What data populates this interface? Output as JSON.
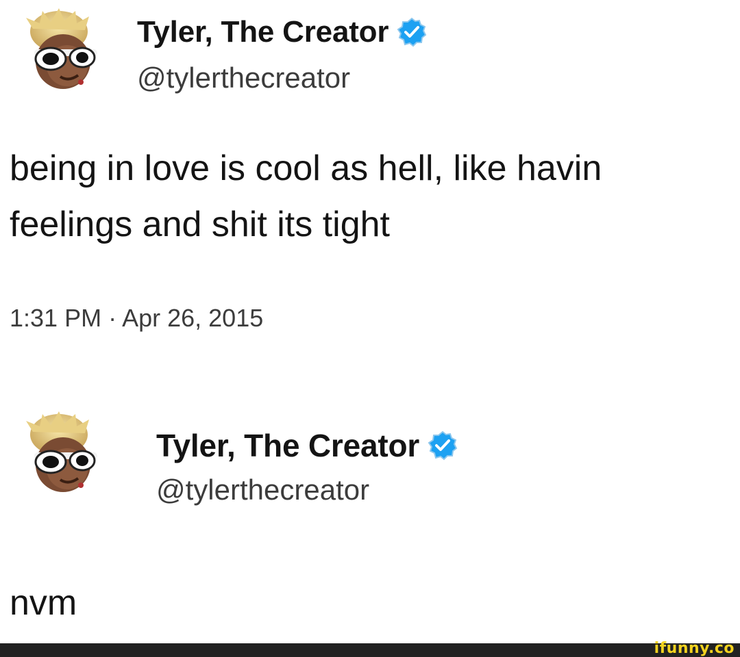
{
  "tweets": [
    {
      "display_name": "Tyler, The Creator",
      "handle": "@tylerthecreator",
      "verified": true,
      "text_lines": [
        "being in love is cool as hell, like havin",
        "feelings and shit its tight"
      ],
      "timestamp": "1:31 PM · Apr 26, 2015",
      "avatar_icon": "avatar-icon"
    },
    {
      "display_name": "Tyler, The Creator",
      "handle": "@tylerthecreator",
      "verified": true,
      "text_lines": [
        "nvm"
      ],
      "avatar_icon": "avatar-icon"
    }
  ],
  "watermark": "ifunny.co",
  "colors": {
    "verified_badge": "#1da1f2",
    "text": "#141414",
    "secondary_text": "#3c3c3c",
    "watermark": "#f4d21f",
    "footer_bar": "#222222"
  }
}
